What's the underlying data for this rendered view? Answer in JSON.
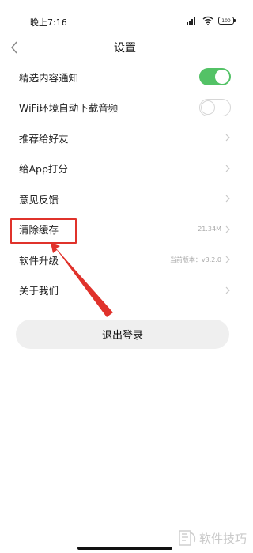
{
  "status_bar": {
    "time": "晚上7:16",
    "battery": "100"
  },
  "header": {
    "title": "设置"
  },
  "settings": [
    {
      "label": "精选内容通知",
      "control": "toggle",
      "state": "on"
    },
    {
      "label": "WiFi环境自动下载音频",
      "control": "toggle",
      "state": "off"
    },
    {
      "label": "推荐给好友",
      "control": "chevron"
    },
    {
      "label": "给App打分",
      "control": "chevron"
    },
    {
      "label": "意见反馈",
      "control": "chevron"
    },
    {
      "label": "清除缓存",
      "control": "chevron",
      "value": "21.34M"
    },
    {
      "label": "软件升级",
      "control": "chevron",
      "value": "当前版本：v3.2.0"
    },
    {
      "label": "关于我们",
      "control": "chevron"
    }
  ],
  "logout": {
    "label": "退出登录"
  },
  "watermark": {
    "text": "软件技巧"
  },
  "colors": {
    "toggle_on": "#53c266",
    "highlight": "#e0322b",
    "logout_bg": "#efefef"
  }
}
